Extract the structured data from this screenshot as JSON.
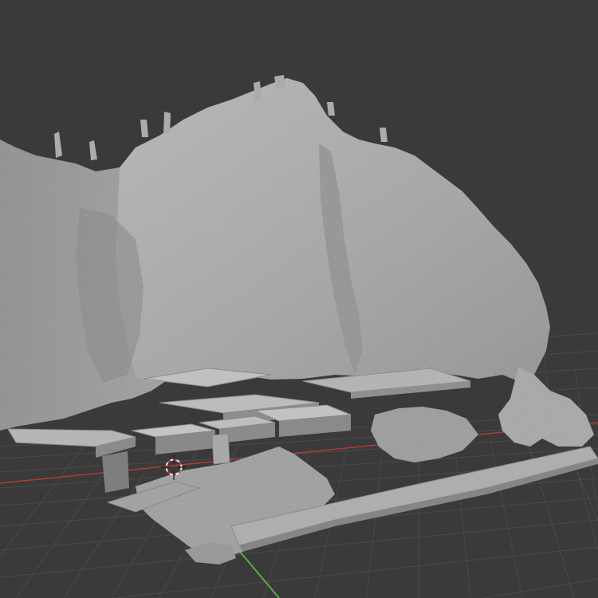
{
  "viewport": {
    "background": "#3a3a3a",
    "grid_color": "#4a4a4a",
    "x_axis_color": "#b03a3a",
    "y_axis_color": "#5fa84a",
    "mesh_color": "#a9a9a9",
    "cursor_colors": [
      "#d23a3a",
      "#f0f0f0"
    ]
  },
  "icons": {
    "cursor": "3d-cursor-icon"
  }
}
